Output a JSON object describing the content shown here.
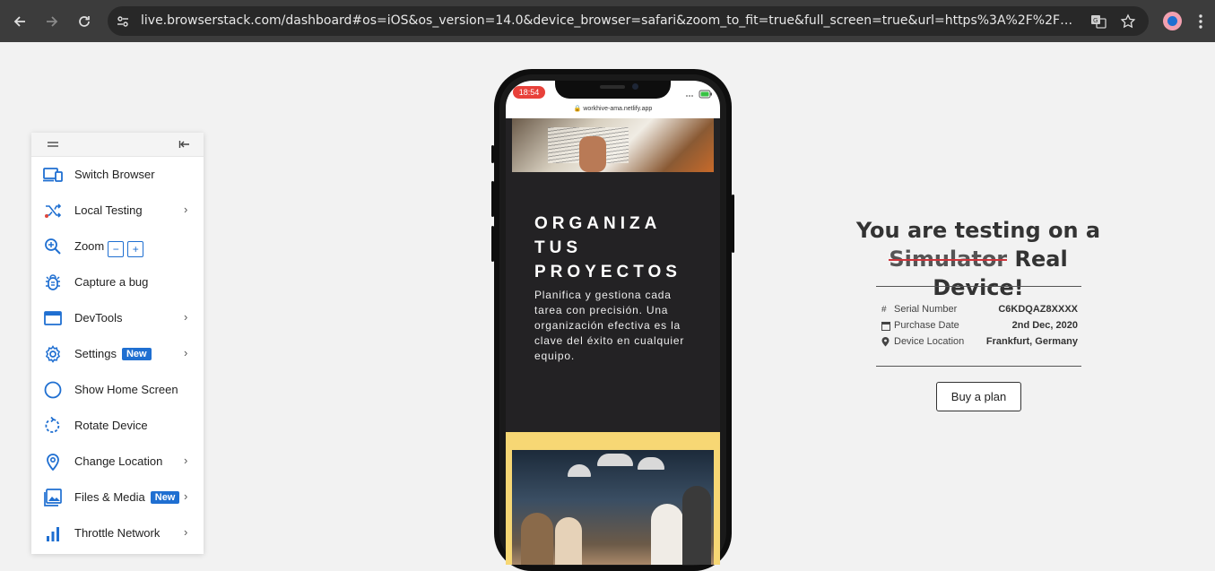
{
  "browser": {
    "url": "live.browserstack.com/dashboard#os=iOS&os_version=14.0&device_browser=safari&zoom_to_fit=true&full_screen=true&url=https%3A%2F%2Fworkhive-ama.netli..."
  },
  "panel": {
    "items": [
      {
        "label": "Switch Browser",
        "icon": "switch-browser-icon"
      },
      {
        "label": "Local Testing",
        "icon": "local-testing-icon"
      },
      {
        "label": "Zoom",
        "icon": "zoom-icon",
        "minus": "−",
        "plus": "+"
      },
      {
        "label": "Capture a bug",
        "icon": "bug-icon"
      },
      {
        "label": "DevTools",
        "icon": "devtools-icon"
      },
      {
        "label": "Settings",
        "icon": "gear-icon",
        "badge": "New"
      },
      {
        "label": "Show Home Screen",
        "icon": "home-circle-icon"
      },
      {
        "label": "Rotate Device",
        "icon": "rotate-icon"
      },
      {
        "label": "Change Location",
        "icon": "location-pin-icon"
      },
      {
        "label": "Files & Media",
        "icon": "image-icon",
        "badge": "New"
      },
      {
        "label": "Throttle Network",
        "icon": "network-bars-icon"
      }
    ]
  },
  "phone": {
    "time": "18:54",
    "address": "workhive-ama.netlify.app",
    "hero_title_lines": [
      "ORGANIZA",
      "TUS",
      "PROYECTOS"
    ],
    "hero_text": "Planifica y gestiona cada tarea con precisión. Una organización efectiva es la clave del éxito en cualquier equipo."
  },
  "info": {
    "title_line1": "You are testing on a",
    "struck": "Simulator",
    "title_rest": " Real Device!",
    "rows": [
      {
        "icon": "#",
        "label": "Serial Number",
        "value": "C6KDQAZ8XXXX"
      },
      {
        "icon": "calendar-icon",
        "label": "Purchase Date",
        "value": "2nd Dec, 2020"
      },
      {
        "icon": "location-pin-icon",
        "label": "Device Location",
        "value": "Frankfurt, Germany"
      }
    ],
    "buy_label": "Buy a plan"
  },
  "colors": {
    "accent": "#1f6fd1",
    "strike": "#d0343b",
    "time_pill": "#e8413a",
    "site_bg": "#232224",
    "site_yellow": "#f7d774"
  }
}
